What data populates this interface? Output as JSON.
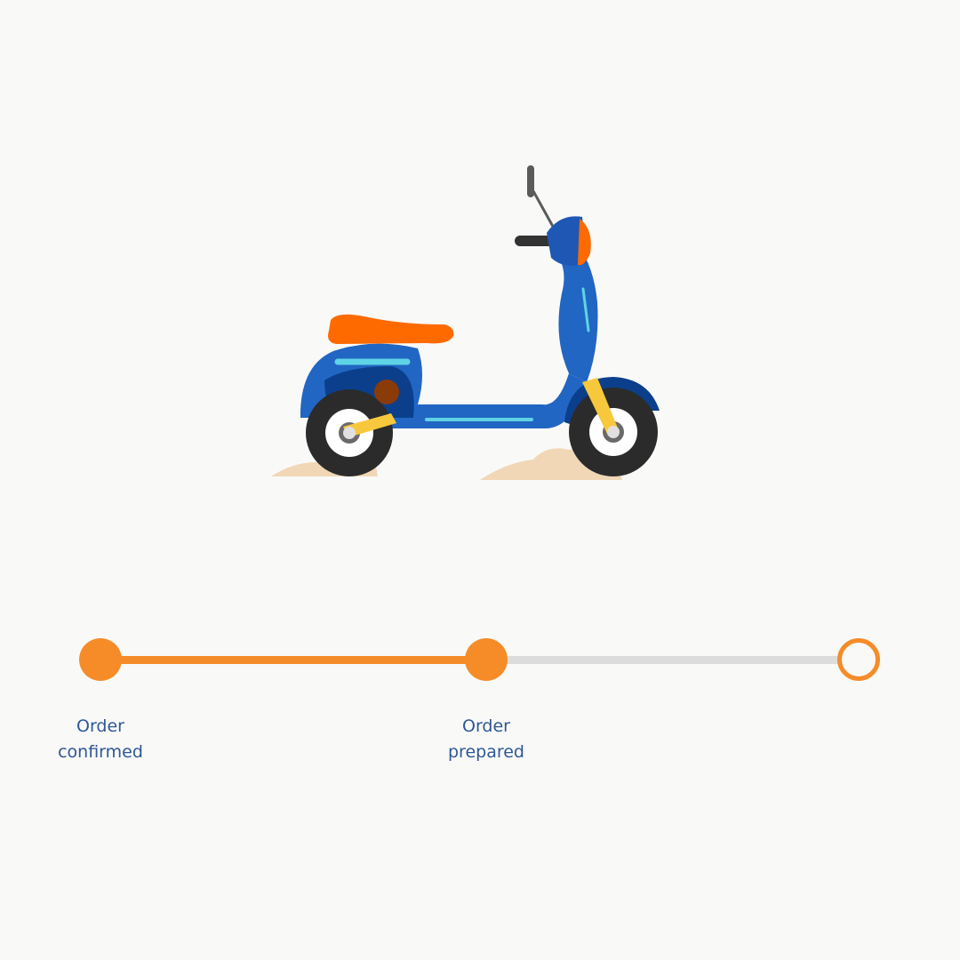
{
  "tracker": {
    "progress_fraction": 0.51,
    "accent_color": "#f58c28",
    "track_color": "#dcdcdc",
    "label_color": "#2e5894",
    "steps": [
      {
        "label": "Order\nconfirmed",
        "state": "done"
      },
      {
        "label": "Order\nprepared",
        "state": "done"
      },
      {
        "label": "",
        "state": "pending"
      }
    ]
  },
  "illustration": {
    "icon": "scooter-icon"
  }
}
